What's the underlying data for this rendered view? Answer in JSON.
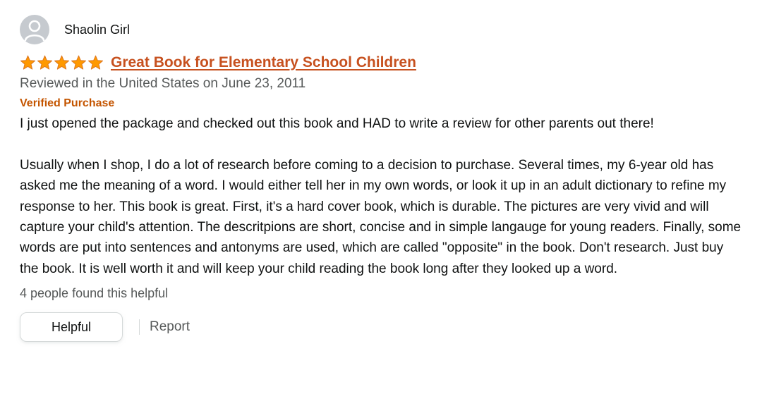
{
  "profile": {
    "name": "Shaolin Girl",
    "avatar_icon": "person-avatar-icon"
  },
  "review": {
    "rating": 5,
    "rating_max": 5,
    "star_color": "#ff9900",
    "title": "Great Book for Elementary School Children",
    "date": "Reviewed in the United States on June 23, 2011",
    "verified": "Verified Purchase",
    "body": [
      "I just opened the package and checked out this book and HAD to write a review for other parents out there!",
      "Usually when I shop, I do a lot of research before coming to a decision to purchase. Several times, my 6-year old has asked me the meaning of a word. I would either tell her in my own words, or look it up in an adult dictionary to refine my response to her. This book is great. First, it's a hard cover book, which is durable. The pictures are very vivid and will capture your child's attention. The descritpions are short, concise and in simple langauge for young readers. Finally, some words are put into sentences and antonyms are used, which are called \"opposite\" in the book. Don't research. Just buy the book. It is well worth it and will keep your child reading the book long after they looked up a word."
    ],
    "helpful_count_text": "4 people found this helpful"
  },
  "actions": {
    "helpful_label": "Helpful",
    "report_label": "Report"
  },
  "colors": {
    "title_link": "#c7511f",
    "verified": "#c45500",
    "muted_text": "#565959",
    "avatar_bg": "#c6cacf"
  }
}
